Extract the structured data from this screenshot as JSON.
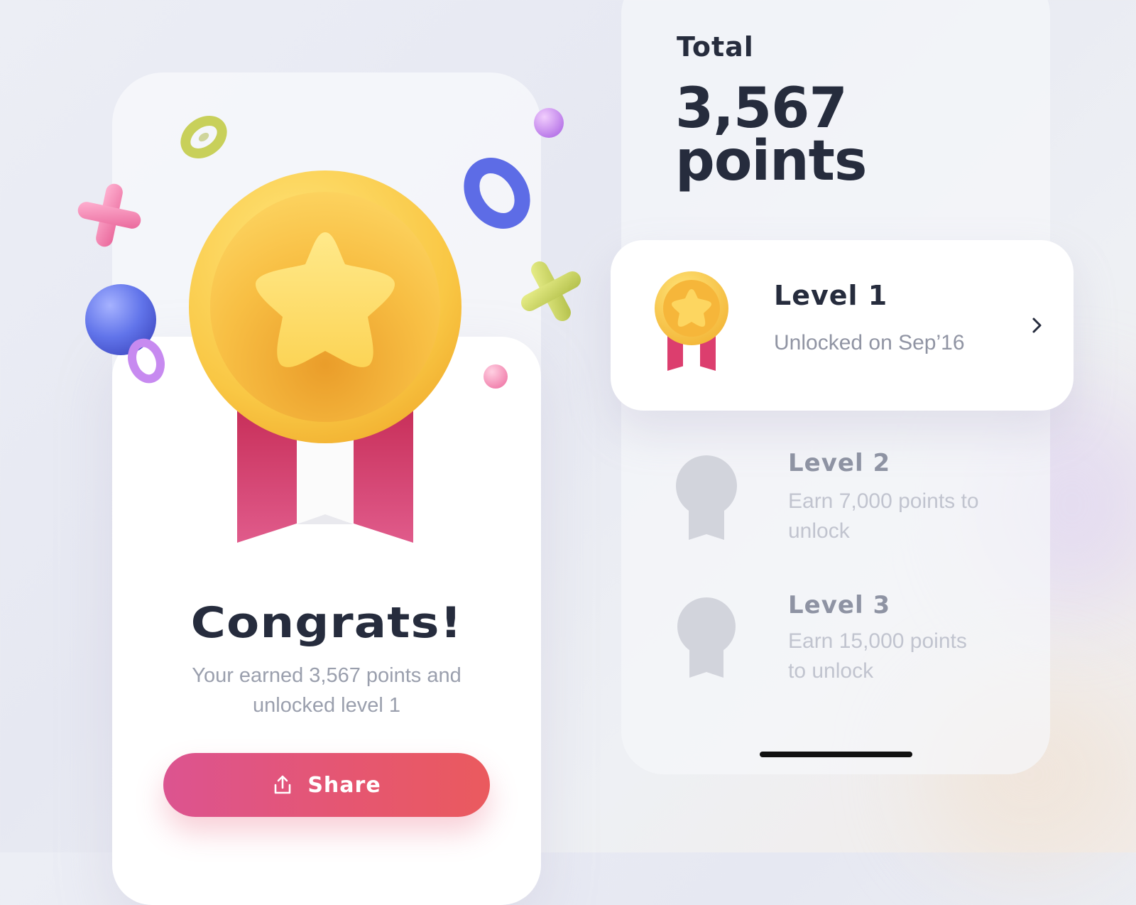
{
  "congrats_screen": {
    "title": "Congrats!",
    "subtitle_line1": "Your earned 3,567 points and",
    "subtitle_line2": "unlocked level 1",
    "share_button": {
      "label": "Share",
      "icon": "share-upload-icon"
    }
  },
  "points_screen": {
    "total_label": "Total",
    "total_value": "3,567",
    "total_unit": "points",
    "levels": [
      {
        "title": "Level 1",
        "subtitle": "Unlocked on Sep’16",
        "state": "unlocked",
        "icon": "gold-medal-icon",
        "action_icon": "chevron-right-icon"
      },
      {
        "title": "Level 2",
        "subtitle_line1": "Earn 7,000 points to",
        "subtitle_line2": "unlock",
        "state": "locked",
        "icon": "locked-medal-icon"
      },
      {
        "title": "Level 3",
        "subtitle_line1": "Earn 15,000 points",
        "subtitle_line2": "to unlock",
        "state": "locked",
        "icon": "locked-medal-icon"
      }
    ]
  },
  "colors": {
    "accent_gradient_start": "#dc5490",
    "accent_gradient_end": "#ea5a5e",
    "medal_gold": "#f8c445",
    "ribbon_pink": "#dc3e6e",
    "text_dark": "#262c3d",
    "text_muted": "#9094a3"
  }
}
